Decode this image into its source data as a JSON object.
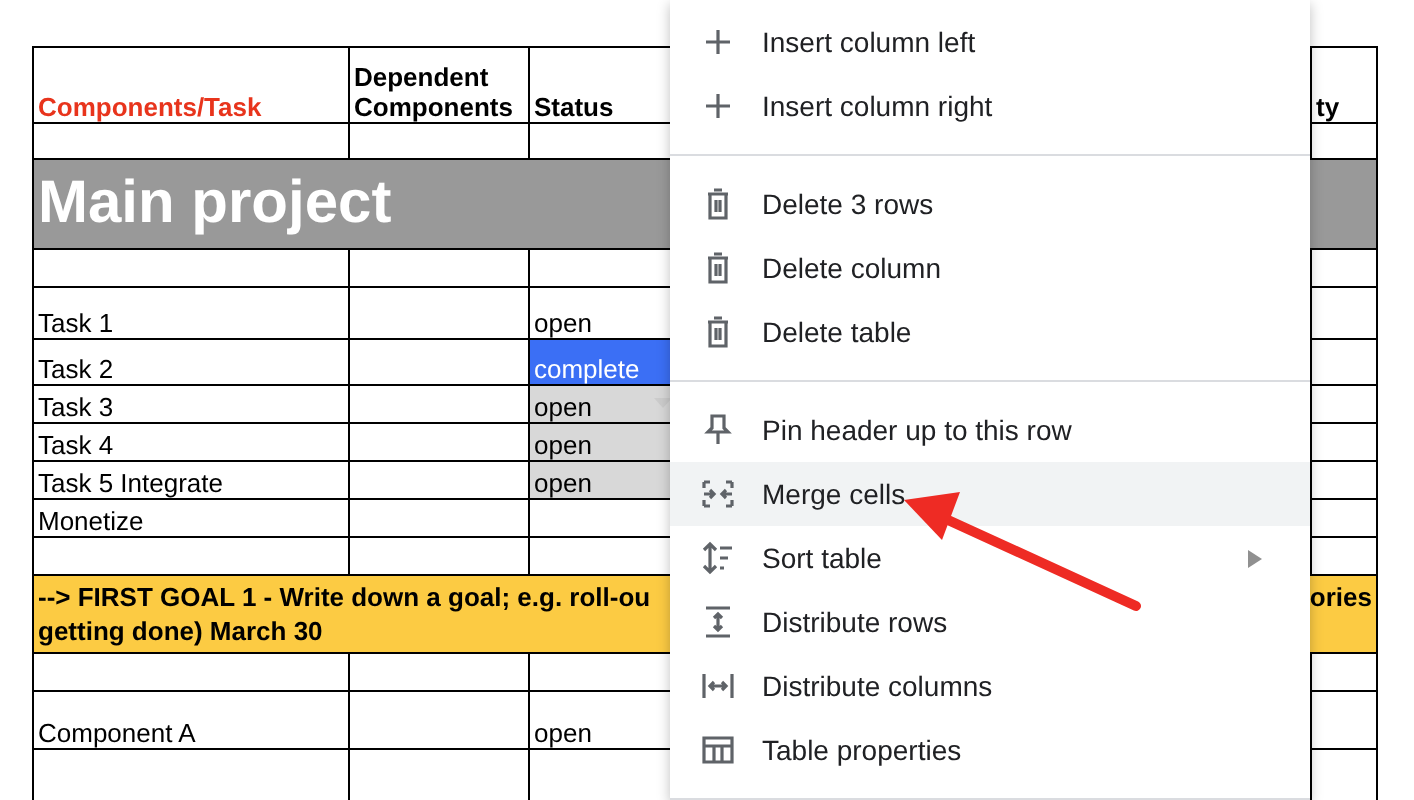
{
  "table": {
    "columns": [
      {
        "label": "Components/Task",
        "accent": true
      },
      {
        "label": "Dependent Components",
        "accent": false
      },
      {
        "label": "Status",
        "accent": false
      },
      {
        "label": "ty",
        "accent": false
      }
    ],
    "rows": [
      {
        "kind": "blank"
      },
      {
        "kind": "banner",
        "text": "Main project"
      },
      {
        "kind": "blank"
      },
      {
        "kind": "task",
        "name": "Task 1",
        "status": {
          "text": "open",
          "selected": false,
          "shaded": false,
          "dropdown": false
        }
      },
      {
        "kind": "task",
        "name": "Task 2",
        "status": {
          "text": "complete",
          "selected": true,
          "shaded": false,
          "dropdown": false
        }
      },
      {
        "kind": "task",
        "name": "Task 3",
        "status": {
          "text": "open",
          "selected": false,
          "shaded": true,
          "dropdown": true
        }
      },
      {
        "kind": "task",
        "name": "Task 4",
        "status": {
          "text": "open",
          "selected": false,
          "shaded": true,
          "dropdown": false
        }
      },
      {
        "kind": "task",
        "name": "Task 5 Integrate",
        "status": {
          "text": "open",
          "selected": false,
          "shaded": true,
          "dropdown": false
        }
      },
      {
        "kind": "task",
        "name": "Monetize"
      },
      {
        "kind": "blank"
      },
      {
        "kind": "goal",
        "lines": [
          "--> FIRST GOAL 1 - Write down a goal; e.g. roll-ou",
          "getting done) March 30"
        ],
        "right": "ories"
      },
      {
        "kind": "blank"
      },
      {
        "kind": "task",
        "name": "Component A",
        "status": {
          "text": "open",
          "selected": false,
          "shaded": false,
          "dropdown": false
        }
      },
      {
        "kind": "blank"
      }
    ]
  },
  "context_menu": {
    "items": [
      {
        "kind": "item",
        "label": "Insert column left",
        "selected": false,
        "submenu": false
      },
      {
        "kind": "item",
        "label": "Insert column right",
        "selected": false,
        "submenu": false
      },
      {
        "kind": "divider"
      },
      {
        "kind": "item",
        "label": "Delete 3 rows",
        "selected": false,
        "submenu": false
      },
      {
        "kind": "item",
        "label": "Delete column",
        "selected": false,
        "submenu": false
      },
      {
        "kind": "item",
        "label": "Delete table",
        "selected": false,
        "submenu": false
      },
      {
        "kind": "divider"
      },
      {
        "kind": "item",
        "label": "Pin header up to this row",
        "selected": false,
        "submenu": false
      },
      {
        "kind": "item",
        "label": "Merge cells",
        "selected": true,
        "submenu": false
      },
      {
        "kind": "item",
        "label": "Sort table",
        "selected": false,
        "submenu": true
      },
      {
        "kind": "item",
        "label": "Distribute rows",
        "selected": false,
        "submenu": false
      },
      {
        "kind": "item",
        "label": "Distribute columns",
        "selected": false,
        "submenu": false
      },
      {
        "kind": "item",
        "label": "Table properties",
        "selected": false,
        "submenu": false
      },
      {
        "kind": "divider"
      }
    ]
  }
}
